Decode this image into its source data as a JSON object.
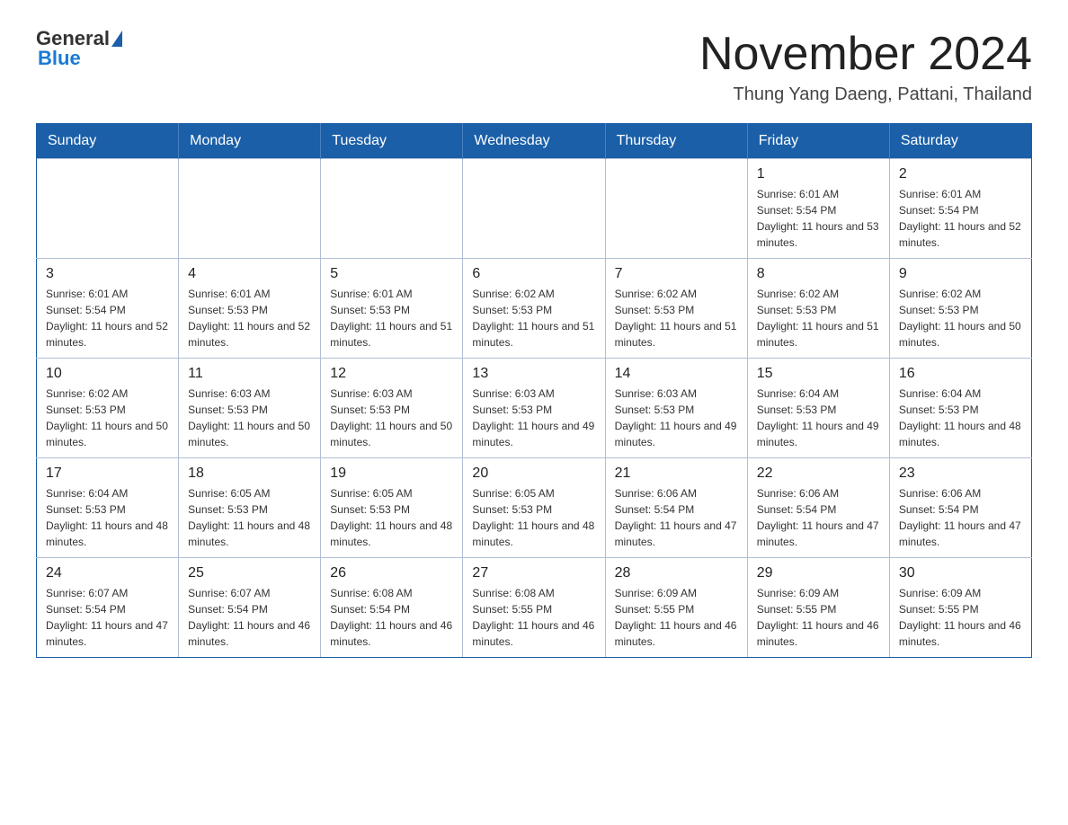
{
  "header": {
    "logo_general": "General",
    "logo_blue": "Blue",
    "month_title": "November 2024",
    "subtitle": "Thung Yang Daeng, Pattani, Thailand"
  },
  "days_of_week": [
    "Sunday",
    "Monday",
    "Tuesday",
    "Wednesday",
    "Thursday",
    "Friday",
    "Saturday"
  ],
  "weeks": [
    [
      {
        "day": "",
        "info": ""
      },
      {
        "day": "",
        "info": ""
      },
      {
        "day": "",
        "info": ""
      },
      {
        "day": "",
        "info": ""
      },
      {
        "day": "",
        "info": ""
      },
      {
        "day": "1",
        "info": "Sunrise: 6:01 AM\nSunset: 5:54 PM\nDaylight: 11 hours and 53 minutes."
      },
      {
        "day": "2",
        "info": "Sunrise: 6:01 AM\nSunset: 5:54 PM\nDaylight: 11 hours and 52 minutes."
      }
    ],
    [
      {
        "day": "3",
        "info": "Sunrise: 6:01 AM\nSunset: 5:54 PM\nDaylight: 11 hours and 52 minutes."
      },
      {
        "day": "4",
        "info": "Sunrise: 6:01 AM\nSunset: 5:53 PM\nDaylight: 11 hours and 52 minutes."
      },
      {
        "day": "5",
        "info": "Sunrise: 6:01 AM\nSunset: 5:53 PM\nDaylight: 11 hours and 51 minutes."
      },
      {
        "day": "6",
        "info": "Sunrise: 6:02 AM\nSunset: 5:53 PM\nDaylight: 11 hours and 51 minutes."
      },
      {
        "day": "7",
        "info": "Sunrise: 6:02 AM\nSunset: 5:53 PM\nDaylight: 11 hours and 51 minutes."
      },
      {
        "day": "8",
        "info": "Sunrise: 6:02 AM\nSunset: 5:53 PM\nDaylight: 11 hours and 51 minutes."
      },
      {
        "day": "9",
        "info": "Sunrise: 6:02 AM\nSunset: 5:53 PM\nDaylight: 11 hours and 50 minutes."
      }
    ],
    [
      {
        "day": "10",
        "info": "Sunrise: 6:02 AM\nSunset: 5:53 PM\nDaylight: 11 hours and 50 minutes."
      },
      {
        "day": "11",
        "info": "Sunrise: 6:03 AM\nSunset: 5:53 PM\nDaylight: 11 hours and 50 minutes."
      },
      {
        "day": "12",
        "info": "Sunrise: 6:03 AM\nSunset: 5:53 PM\nDaylight: 11 hours and 50 minutes."
      },
      {
        "day": "13",
        "info": "Sunrise: 6:03 AM\nSunset: 5:53 PM\nDaylight: 11 hours and 49 minutes."
      },
      {
        "day": "14",
        "info": "Sunrise: 6:03 AM\nSunset: 5:53 PM\nDaylight: 11 hours and 49 minutes."
      },
      {
        "day": "15",
        "info": "Sunrise: 6:04 AM\nSunset: 5:53 PM\nDaylight: 11 hours and 49 minutes."
      },
      {
        "day": "16",
        "info": "Sunrise: 6:04 AM\nSunset: 5:53 PM\nDaylight: 11 hours and 48 minutes."
      }
    ],
    [
      {
        "day": "17",
        "info": "Sunrise: 6:04 AM\nSunset: 5:53 PM\nDaylight: 11 hours and 48 minutes."
      },
      {
        "day": "18",
        "info": "Sunrise: 6:05 AM\nSunset: 5:53 PM\nDaylight: 11 hours and 48 minutes."
      },
      {
        "day": "19",
        "info": "Sunrise: 6:05 AM\nSunset: 5:53 PM\nDaylight: 11 hours and 48 minutes."
      },
      {
        "day": "20",
        "info": "Sunrise: 6:05 AM\nSunset: 5:53 PM\nDaylight: 11 hours and 48 minutes."
      },
      {
        "day": "21",
        "info": "Sunrise: 6:06 AM\nSunset: 5:54 PM\nDaylight: 11 hours and 47 minutes."
      },
      {
        "day": "22",
        "info": "Sunrise: 6:06 AM\nSunset: 5:54 PM\nDaylight: 11 hours and 47 minutes."
      },
      {
        "day": "23",
        "info": "Sunrise: 6:06 AM\nSunset: 5:54 PM\nDaylight: 11 hours and 47 minutes."
      }
    ],
    [
      {
        "day": "24",
        "info": "Sunrise: 6:07 AM\nSunset: 5:54 PM\nDaylight: 11 hours and 47 minutes."
      },
      {
        "day": "25",
        "info": "Sunrise: 6:07 AM\nSunset: 5:54 PM\nDaylight: 11 hours and 46 minutes."
      },
      {
        "day": "26",
        "info": "Sunrise: 6:08 AM\nSunset: 5:54 PM\nDaylight: 11 hours and 46 minutes."
      },
      {
        "day": "27",
        "info": "Sunrise: 6:08 AM\nSunset: 5:55 PM\nDaylight: 11 hours and 46 minutes."
      },
      {
        "day": "28",
        "info": "Sunrise: 6:09 AM\nSunset: 5:55 PM\nDaylight: 11 hours and 46 minutes."
      },
      {
        "day": "29",
        "info": "Sunrise: 6:09 AM\nSunset: 5:55 PM\nDaylight: 11 hours and 46 minutes."
      },
      {
        "day": "30",
        "info": "Sunrise: 6:09 AM\nSunset: 5:55 PM\nDaylight: 11 hours and 46 minutes."
      }
    ]
  ]
}
